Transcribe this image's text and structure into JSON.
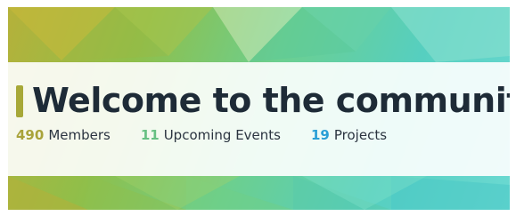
{
  "hero": {
    "title": "Welcome to the community",
    "stats": [
      {
        "value": "490",
        "label": "Members",
        "color": "#a9a33a"
      },
      {
        "value": "11",
        "label": "Upcoming Events",
        "color": "#67c083"
      },
      {
        "value": "19",
        "label": "Projects",
        "color": "#2a9fd6"
      }
    ]
  },
  "colors": {
    "title_text": "#1e2b37",
    "accent_bar": "#a7a838"
  }
}
